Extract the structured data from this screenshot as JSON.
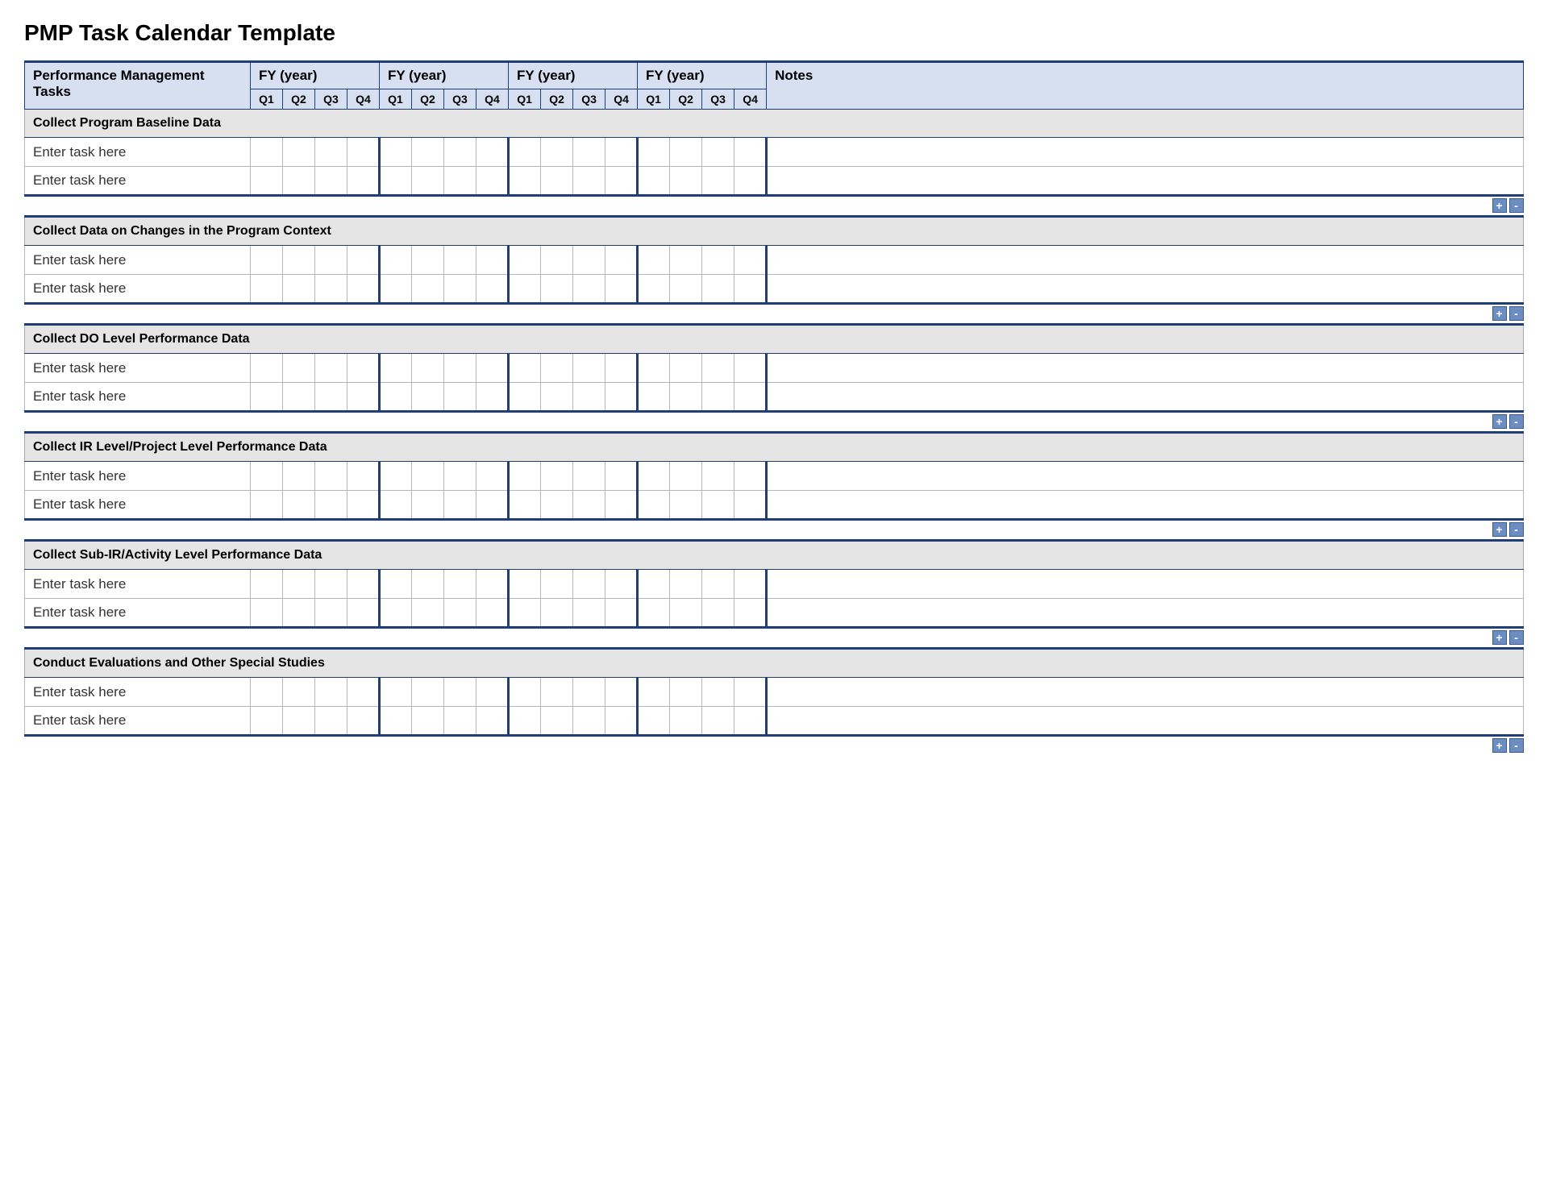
{
  "title": "PMP Task Calendar Template",
  "header": {
    "tasks_label": "Performance Management Tasks",
    "notes_label": "Notes",
    "fy_label": "FY  (year)",
    "quarters": [
      "Q1",
      "Q2",
      "Q3",
      "Q4"
    ]
  },
  "placeholder_task": "Enter task here",
  "buttons": {
    "add": "+",
    "remove": "-"
  },
  "sections": [
    {
      "label": "Collect Program Baseline Data",
      "rows": 2
    },
    {
      "label": "Collect Data on Changes in the Program Context",
      "rows": 2
    },
    {
      "label": "Collect DO Level Performance Data",
      "rows": 2
    },
    {
      "label": "Collect IR Level/Project Level Performance Data",
      "rows": 2
    },
    {
      "label": "Collect Sub-IR/Activity Level Performance Data",
      "rows": 2
    },
    {
      "label": "Conduct Evaluations and Other Special Studies",
      "rows": 2
    }
  ]
}
